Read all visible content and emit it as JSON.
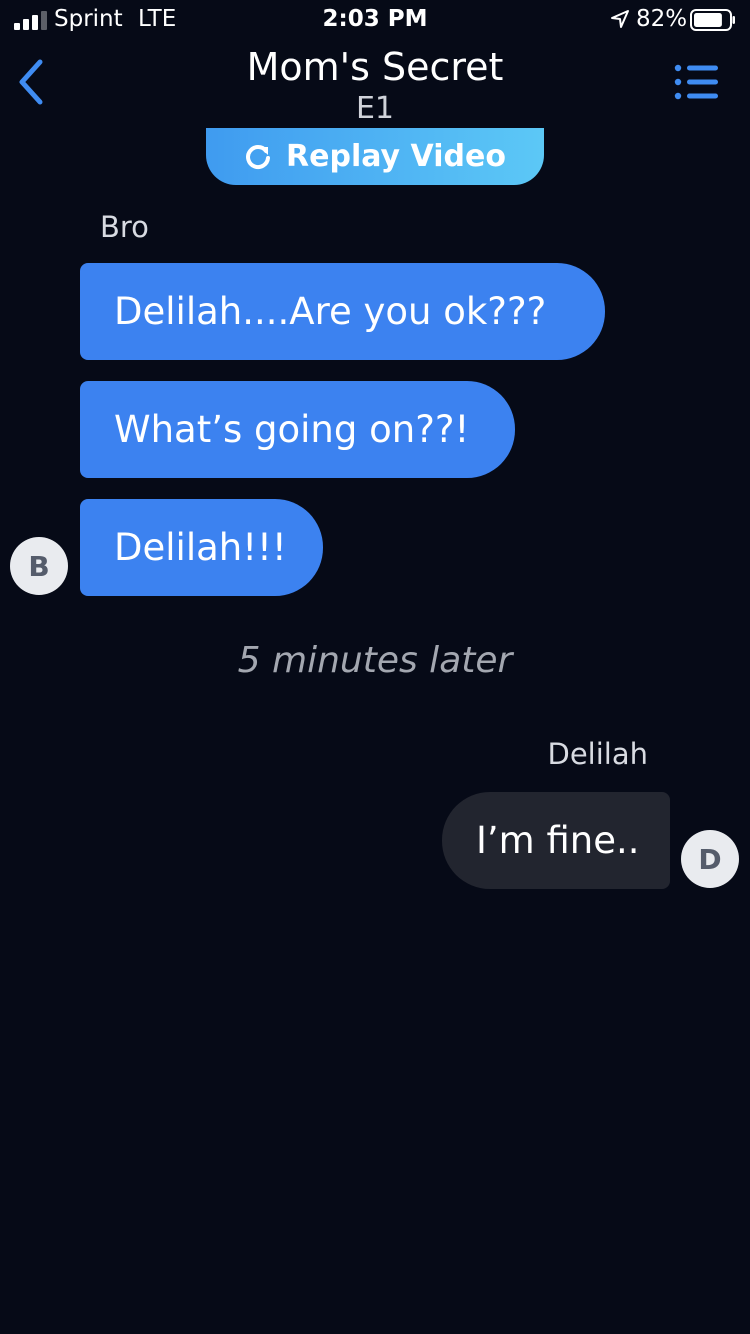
{
  "status_bar": {
    "carrier": "Sprint",
    "network": "LTE",
    "time": "2:03 PM",
    "battery_percent": "82%",
    "battery_level": 0.82
  },
  "header": {
    "title": "Mom's Secret",
    "subtitle": "E1",
    "back_icon": "chevron-left-icon",
    "menu_icon": "list-icon"
  },
  "replay": {
    "label": "Replay Video",
    "icon": "refresh-icon"
  },
  "thread": {
    "incoming_sender": "Bro",
    "incoming_avatar": "B",
    "incoming_messages": [
      "Delilah....Are you ok???",
      "What’s going on??!",
      "Delilah!!!"
    ],
    "time_divider": "5 minutes later",
    "outgoing_sender": "Delilah",
    "outgoing_avatar": "D",
    "outgoing_messages": [
      "I’m fine.."
    ]
  },
  "colors": {
    "background": "#060a17",
    "accent": "#3c82f0",
    "incoming_bubble": "#3c82f0",
    "outgoing_bubble": "#22252f",
    "nav_icon": "#3f8cf2"
  }
}
